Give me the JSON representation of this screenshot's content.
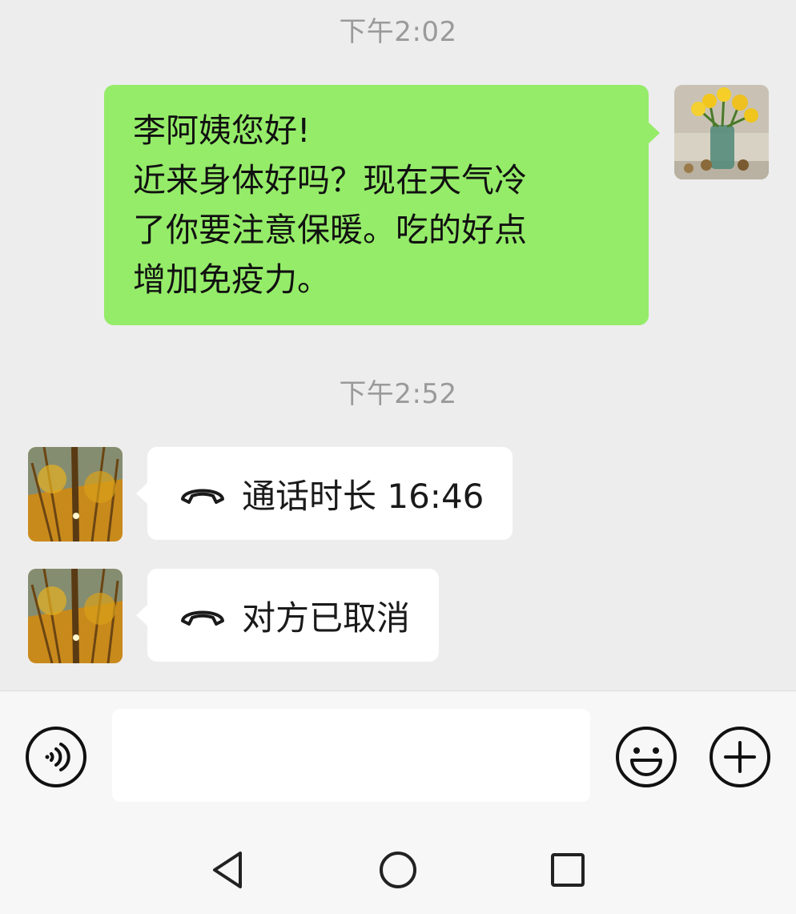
{
  "chat": {
    "time1": "下午2:02",
    "sent_message": {
      "lines": [
        "李阿姨您好!",
        "近来身体好吗？现在天气冷",
        "了你要注意保暖。吃的好点",
        "增加免疫力。"
      ]
    },
    "time2": "下午2:52",
    "call_messages": [
      {
        "text": "通话时长 16:46",
        "icon": "phone-hangup-icon"
      },
      {
        "text": "对方已取消",
        "icon": "phone-hangup-icon"
      }
    ]
  },
  "input_bar": {
    "voice_icon": "voice-mode-icon",
    "input_value": "",
    "emoji_icon": "emoji-icon",
    "plus_icon": "plus-icon"
  },
  "nav_bar": {
    "icons": [
      "back-triangle-icon",
      "home-circle-icon",
      "recents-square-icon"
    ]
  },
  "colors": {
    "background": "#ededed",
    "sent_bubble": "#95ec69",
    "received_bubble": "#ffffff",
    "timestamp": "#9a9a9a"
  }
}
